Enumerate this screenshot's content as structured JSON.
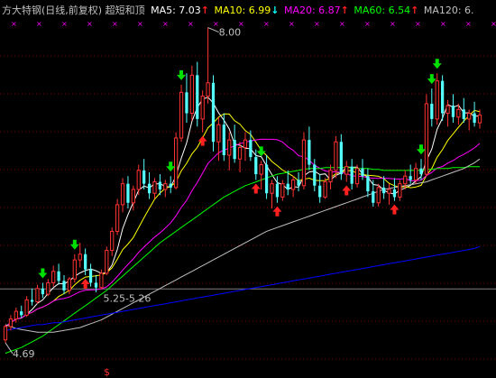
{
  "header": {
    "title": "方大特钢(日线,前复权) 超短和顶",
    "ma5_label": "MA5: 7.03",
    "ma5_arrow": "↑",
    "ma10_label": "MA10: 6.99",
    "ma10_arrow": "↓",
    "ma20_label": "MA20: 6.87",
    "ma20_arrow": "↑",
    "ma60_label": "MA60: 6.54",
    "ma60_arrow": "↑",
    "ma120_label": "MA120: 6."
  },
  "colors": {
    "background": "#000000",
    "title": "#c0c0c0",
    "ma5": "#ffffff",
    "ma10": "#ffff00",
    "ma20": "#ff00ff",
    "ma60": "#00ff00",
    "ma120": "#c0c0c0",
    "ma250": "#0000ff",
    "up_candle": "#ff3232",
    "down_candle": "#54ffff",
    "up_arrow": "#ff2020",
    "down_arrow": "#00e000",
    "grid": "#800000",
    "marker": "#ff00ff"
  },
  "chart_data": {
    "type": "candlestick",
    "ylim": [
      4.5,
      8.1
    ],
    "annotations": {
      "high_label": "8.00",
      "low_label": "4.69",
      "range_label": "5.25-5.26",
      "bottom_symbol": "$"
    },
    "support_line": 5.255,
    "candles": [
      [
        4.72,
        4.88,
        4.69,
        4.86
      ],
      [
        4.86,
        4.98,
        4.82,
        4.94
      ],
      [
        4.94,
        5.06,
        4.9,
        5.02
      ],
      [
        5.02,
        5.08,
        4.95,
        4.98
      ],
      [
        4.98,
        5.18,
        4.96,
        5.14
      ],
      [
        5.14,
        5.26,
        5.08,
        5.12
      ],
      [
        5.12,
        5.3,
        5.1,
        5.26
      ],
      [
        5.26,
        5.32,
        5.16,
        5.2
      ],
      [
        5.2,
        5.36,
        5.18,
        5.32
      ],
      [
        5.32,
        5.5,
        5.28,
        5.44
      ],
      [
        5.44,
        5.52,
        5.3,
        5.34
      ],
      [
        5.34,
        5.4,
        5.2,
        5.24
      ],
      [
        5.24,
        5.38,
        5.2,
        5.36
      ],
      [
        5.36,
        5.62,
        5.32,
        5.56
      ],
      [
        5.56,
        5.74,
        5.48,
        5.62
      ],
      [
        5.62,
        5.68,
        5.4,
        5.46
      ],
      [
        5.46,
        5.52,
        5.28,
        5.32
      ],
      [
        5.32,
        5.4,
        5.22,
        5.27
      ],
      [
        5.27,
        5.46,
        5.25,
        5.42
      ],
      [
        5.42,
        5.7,
        5.4,
        5.66
      ],
      [
        5.66,
        5.9,
        5.6,
        5.86
      ],
      [
        5.86,
        6.2,
        5.82,
        6.14
      ],
      [
        6.14,
        6.42,
        6.06,
        6.36
      ],
      [
        6.36,
        6.44,
        6.1,
        6.16
      ],
      [
        6.16,
        6.34,
        6.08,
        6.3
      ],
      [
        6.3,
        6.56,
        6.24,
        6.5
      ],
      [
        6.5,
        6.62,
        6.3,
        6.36
      ],
      [
        6.36,
        6.48,
        6.2,
        6.26
      ],
      [
        6.26,
        6.42,
        6.2,
        6.38
      ],
      [
        6.38,
        6.46,
        6.24,
        6.3
      ],
      [
        6.3,
        6.4,
        6.22,
        6.36
      ],
      [
        6.36,
        6.44,
        6.26,
        6.32
      ],
      [
        6.32,
        6.9,
        6.3,
        6.84
      ],
      [
        6.84,
        7.4,
        6.8,
        7.32
      ],
      [
        7.32,
        7.52,
        7.0,
        7.1
      ],
      [
        7.1,
        7.6,
        7.02,
        7.5
      ],
      [
        7.5,
        7.64,
        6.96,
        7.04
      ],
      [
        7.04,
        7.34,
        6.9,
        7.28
      ],
      [
        7.28,
        8.0,
        7.2,
        7.42
      ],
      [
        7.42,
        7.5,
        6.7,
        6.8
      ],
      [
        6.8,
        7.06,
        6.6,
        6.98
      ],
      [
        6.98,
        7.1,
        6.6,
        6.66
      ],
      [
        6.66,
        6.9,
        6.5,
        6.82
      ],
      [
        6.82,
        6.98,
        6.58,
        6.62
      ],
      [
        6.62,
        6.8,
        6.48,
        6.74
      ],
      [
        6.74,
        6.9,
        6.6,
        6.82
      ],
      [
        6.82,
        6.92,
        6.6,
        6.64
      ],
      [
        6.64,
        6.72,
        6.4,
        6.46
      ],
      [
        6.46,
        6.6,
        6.3,
        6.56
      ],
      [
        6.56,
        6.66,
        6.2,
        6.26
      ],
      [
        6.26,
        6.4,
        6.1,
        6.36
      ],
      [
        6.36,
        6.44,
        6.16,
        6.22
      ],
      [
        6.22,
        6.4,
        6.18,
        6.36
      ],
      [
        6.36,
        6.5,
        6.24,
        6.3
      ],
      [
        6.3,
        6.44,
        6.22,
        6.4
      ],
      [
        6.4,
        6.48,
        6.28,
        6.34
      ],
      [
        6.34,
        6.9,
        6.3,
        6.82
      ],
      [
        6.82,
        6.96,
        6.5,
        6.56
      ],
      [
        6.56,
        6.62,
        6.28,
        6.34
      ],
      [
        6.34,
        6.46,
        6.16,
        6.22
      ],
      [
        6.22,
        6.42,
        6.2,
        6.38
      ],
      [
        6.38,
        6.56,
        6.3,
        6.5
      ],
      [
        6.5,
        6.86,
        6.42,
        6.8
      ],
      [
        6.8,
        6.88,
        6.4,
        6.46
      ],
      [
        6.46,
        6.6,
        6.38,
        6.54
      ],
      [
        6.54,
        6.62,
        6.3,
        6.36
      ],
      [
        6.36,
        6.56,
        6.32,
        6.52
      ],
      [
        6.52,
        6.62,
        6.4,
        6.44
      ],
      [
        6.44,
        6.52,
        6.22,
        6.28
      ],
      [
        6.28,
        6.4,
        6.12,
        6.16
      ],
      [
        6.16,
        6.36,
        6.12,
        6.32
      ],
      [
        6.32,
        6.44,
        6.2,
        6.26
      ],
      [
        6.26,
        6.36,
        6.14,
        6.3
      ],
      [
        6.3,
        6.42,
        6.18,
        6.22
      ],
      [
        6.22,
        6.4,
        6.18,
        6.36
      ],
      [
        6.36,
        6.5,
        6.3,
        6.44
      ],
      [
        6.44,
        6.56,
        6.36,
        6.4
      ],
      [
        6.4,
        6.58,
        6.36,
        6.52
      ],
      [
        6.52,
        6.62,
        6.4,
        6.46
      ],
      [
        6.46,
        7.3,
        6.44,
        7.2
      ],
      [
        7.2,
        7.36,
        6.96,
        7.04
      ],
      [
        7.04,
        7.52,
        6.98,
        7.44
      ],
      [
        7.44,
        7.5,
        7.02,
        7.1
      ],
      [
        7.1,
        7.24,
        6.96,
        7.18
      ],
      [
        7.18,
        7.3,
        7.0,
        7.06
      ],
      [
        7.06,
        7.2,
        6.98,
        7.14
      ],
      [
        7.14,
        7.26,
        7.0,
        7.04
      ],
      [
        7.04,
        7.14,
        6.92,
        7.1
      ],
      [
        7.1,
        7.22,
        6.96,
        7.0
      ],
      [
        7.0,
        7.14,
        6.94,
        7.08
      ]
    ],
    "ma_series": [
      {
        "name": "MA5",
        "period": 5,
        "color": "#ffffff"
      },
      {
        "name": "MA10",
        "period": 10,
        "color": "#ffff00"
      },
      {
        "name": "MA20",
        "period": 20,
        "color": "#ff00ff"
      },
      {
        "name": "MA60",
        "values": [
          4.58,
          4.6,
          4.62,
          4.64,
          4.67,
          4.7,
          4.73,
          4.76,
          4.8,
          4.84,
          4.88,
          4.92,
          4.96,
          5.0,
          5.04,
          5.08,
          5.12,
          5.16,
          5.2,
          5.24,
          5.29,
          5.34,
          5.39,
          5.44,
          5.49,
          5.54,
          5.59,
          5.64,
          5.69,
          5.74,
          5.78,
          5.82,
          5.86,
          5.9,
          5.94,
          5.98,
          6.02,
          6.06,
          6.1,
          6.14,
          6.18,
          6.22,
          6.25,
          6.28,
          6.31,
          6.34,
          6.36,
          6.38,
          6.4,
          6.42,
          6.44,
          6.46,
          6.47,
          6.48,
          6.49,
          6.5,
          6.51,
          6.52,
          6.52,
          6.52,
          6.53,
          6.53,
          6.53,
          6.53,
          6.53,
          6.53,
          6.52,
          6.52,
          6.52,
          6.51,
          6.51,
          6.5,
          6.5,
          6.5,
          6.5,
          6.5,
          6.5,
          6.5,
          6.5,
          6.51,
          6.51,
          6.52,
          6.52,
          6.52,
          6.53,
          6.53,
          6.53,
          6.54,
          6.54,
          6.54
        ],
        "color": "#00ff00"
      },
      {
        "name": "MA120",
        "values": [
          4.88,
          4.86,
          4.84,
          4.83,
          4.82,
          4.81,
          4.8,
          4.8,
          4.8,
          4.8,
          4.81,
          4.82,
          4.83,
          4.84,
          4.85,
          4.87,
          4.89,
          4.91,
          4.93,
          4.96,
          4.99,
          5.02,
          5.05,
          5.08,
          5.11,
          5.14,
          5.17,
          5.2,
          5.23,
          5.26,
          5.29,
          5.32,
          5.35,
          5.38,
          5.41,
          5.44,
          5.47,
          5.5,
          5.53,
          5.56,
          5.59,
          5.62,
          5.65,
          5.68,
          5.71,
          5.74,
          5.77,
          5.8,
          5.83,
          5.86,
          5.88,
          5.9,
          5.92,
          5.94,
          5.96,
          5.98,
          6.0,
          6.02,
          6.04,
          6.06,
          6.08,
          6.1,
          6.12,
          6.14,
          6.16,
          6.18,
          6.2,
          6.22,
          6.24,
          6.26,
          6.28,
          6.3,
          6.31,
          6.32,
          6.33,
          6.34,
          6.35,
          6.36,
          6.37,
          6.38,
          6.4,
          6.42,
          6.44,
          6.46,
          6.48,
          6.5,
          6.52,
          6.55,
          6.58,
          6.62
        ],
        "color": "#c0c0c0"
      },
      {
        "name": "MA250",
        "values": [
          4.82,
          4.83,
          4.84,
          4.85,
          4.86,
          4.87,
          4.88,
          4.88,
          4.89,
          4.9,
          4.9,
          4.91,
          4.92,
          4.93,
          4.94,
          4.95,
          4.96,
          4.97,
          4.98,
          4.99,
          5.0,
          5.01,
          5.02,
          5.03,
          5.04,
          5.05,
          5.06,
          5.07,
          5.08,
          5.09,
          5.1,
          5.11,
          5.12,
          5.13,
          5.14,
          5.15,
          5.16,
          5.17,
          5.18,
          5.19,
          5.2,
          5.21,
          5.22,
          5.23,
          5.24,
          5.25,
          5.26,
          5.27,
          5.28,
          5.29,
          5.3,
          5.31,
          5.32,
          5.33,
          5.34,
          5.35,
          5.36,
          5.37,
          5.38,
          5.39,
          5.4,
          5.41,
          5.42,
          5.43,
          5.44,
          5.45,
          5.46,
          5.47,
          5.48,
          5.49,
          5.5,
          5.51,
          5.52,
          5.53,
          5.54,
          5.55,
          5.56,
          5.57,
          5.58,
          5.59,
          5.6,
          5.61,
          5.62,
          5.63,
          5.64,
          5.65,
          5.66,
          5.67,
          5.68,
          5.7
        ],
        "color": "#0000ff"
      }
    ],
    "down_signals": [
      7,
      13,
      31,
      33,
      48,
      78,
      80,
      81
    ],
    "up_signals": [
      15,
      37,
      47,
      51,
      64,
      73
    ]
  }
}
